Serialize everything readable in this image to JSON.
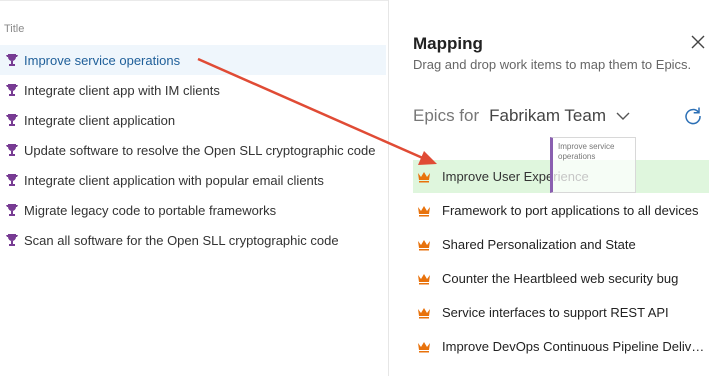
{
  "left_panel": {
    "column_header": "Title",
    "items": [
      {
        "label": "Improve service operations",
        "selected": true
      },
      {
        "label": "Integrate client app with IM clients"
      },
      {
        "label": "Integrate client application"
      },
      {
        "label": "Update software to resolve the Open SLL cryptographic code"
      },
      {
        "label": "Integrate client application with popular email clients"
      },
      {
        "label": "Migrate legacy code to portable frameworks"
      },
      {
        "label": "Scan all software for the Open SLL cryptographic code"
      }
    ]
  },
  "mapping_panel": {
    "title": "Mapping",
    "subtitle": "Drag and drop work items to map them to Epics.",
    "epics_label": "Epics for",
    "team": "Fabrikam Team",
    "epics": [
      {
        "label": "Improve User Experience",
        "highlight": true
      },
      {
        "label": "Framework to port applications to all devices"
      },
      {
        "label": "Shared Personalization and State"
      },
      {
        "label": "Counter the Heartbleed web security bug"
      },
      {
        "label": "Service interfaces to support REST API"
      },
      {
        "label": "Improve DevOps Continuous Pipeline Delivery"
      }
    ]
  },
  "drag_preview": {
    "text": "Improve service operations"
  },
  "colors": {
    "trophy": "#773b93",
    "crown": "#e8720c",
    "highlight": "#dff6dd",
    "arrow": "#e04b35",
    "selected_bg": "#eff6fc"
  },
  "icons": {
    "work_item": "trophy-icon",
    "epic": "crown-icon",
    "close": "close-icon",
    "refresh": "refresh-icon",
    "dropdown": "chevron-down-icon"
  }
}
